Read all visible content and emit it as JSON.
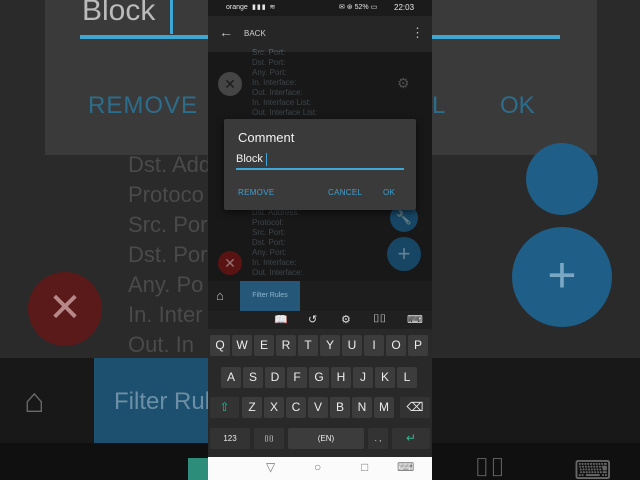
{
  "background": {
    "dialog_text": "Block",
    "remove": "REMOVE",
    "partial_button": "L",
    "ok": "OK",
    "list": [
      "Dst. Add",
      "Protoco",
      "Src. Por",
      "Dst. Por",
      "Any. Po",
      "In. Inter",
      "Out. In"
    ],
    "plus": "+",
    "x": "✕",
    "filter_tab": "Filter Rul"
  },
  "status_bar": {
    "carrier": "orange",
    "signal": "▮▮▮ ≋",
    "right_icons": "✉ ⊛ 52% ▭",
    "time": "22:03"
  },
  "app_bar": {
    "back_arrow": "←",
    "title": "BACK",
    "menu": "⋮"
  },
  "rule_top": {
    "lines": [
      "Src. Port:",
      "Dst. Port:",
      "Any. Port:",
      "In. Interface:",
      "Out. Interface:",
      "In. Interface List:",
      "Out. Interface List:"
    ],
    "remove_icon": "✕",
    "gear_icon": "⚙"
  },
  "rule_bottom": {
    "lines": [
      "Dst. Address:",
      "Protocol:",
      "Src. Port:",
      "Dst. Port:",
      "Any. Port:",
      "In. Interface:",
      "Out. Interface:"
    ],
    "remove_icon": "✕"
  },
  "fabs": {
    "wrench": "🔧",
    "plus": "+"
  },
  "tabs": {
    "home_icon": "⌂",
    "filter_rules": "Filter Rules"
  },
  "keyboard": {
    "toolbar": [
      "📖",
      "↺",
      "⚙",
      "⌷⌷",
      "⌨"
    ],
    "row1": [
      "Q",
      "W",
      "E",
      "R",
      "T",
      "Y",
      "U",
      "I",
      "O",
      "P"
    ],
    "row2": [
      "A",
      "S",
      "D",
      "F",
      "G",
      "H",
      "J",
      "K",
      "L"
    ],
    "row3": [
      "⇧",
      "Z",
      "X",
      "C",
      "V",
      "B",
      "N",
      "M",
      "⌫"
    ],
    "row4": [
      "123",
      "⌷⌷",
      "(EN)",
      ". ,",
      "↵"
    ]
  },
  "nav_bar": {
    "back": "▽",
    "home": "○",
    "recents": "□",
    "keyboard": "⌨"
  },
  "dialog": {
    "title": "Comment",
    "input_value": "Block",
    "remove": "REMOVE",
    "cancel": "CANCEL",
    "ok": "OK"
  },
  "colors": {
    "accent": "#3fa7d6",
    "fab": "#246c9b",
    "danger": "#8a1e1e"
  }
}
